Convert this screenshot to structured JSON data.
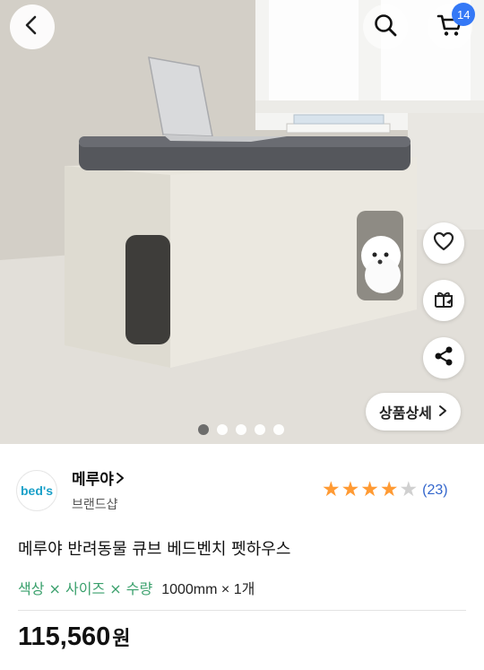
{
  "header": {
    "cart_count": "14"
  },
  "gallery": {
    "detail_button_label": "상품상세",
    "page_total": 5,
    "page_current": 1
  },
  "product": {
    "brand_logo_text": "bed's",
    "brand_name": "메루야",
    "brand_sublabel": "브랜드샵",
    "rating_stars": 4,
    "rating_max": 5,
    "review_count": "(23)",
    "title": "메루야 반려동물 큐브 베드벤치 펫하우스",
    "option_label": "색상 × 사이즈 × 수량",
    "option_value": "1000mm × 1개",
    "price": "115,560",
    "price_unit": "원"
  },
  "icons": {
    "back": "chevron-left-icon",
    "search": "search-icon",
    "cart": "cart-icon",
    "favorite": "heart-icon",
    "gift": "gift-icon",
    "share": "share-icon",
    "detail": "chevron-right-icon",
    "star": "star-icon"
  },
  "colors": {
    "badge": "#3478f6",
    "star": "#ff9a33",
    "option_label": "#3aa06c",
    "review_count": "#3366cc"
  }
}
